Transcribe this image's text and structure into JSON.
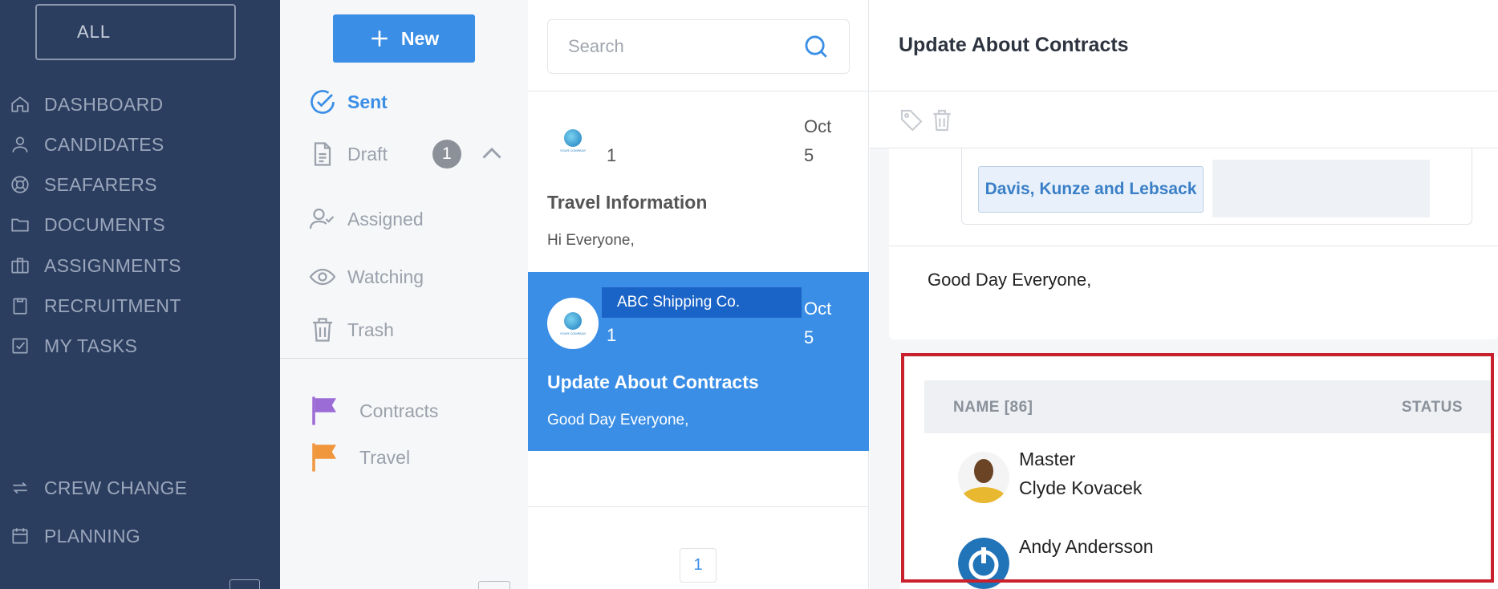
{
  "nav": {
    "filter_label": "ALL",
    "items": [
      {
        "label": "DASHBOARD",
        "icon": "home-icon"
      },
      {
        "label": "CANDIDATES",
        "icon": "user-icon"
      },
      {
        "label": "SEAFARERS",
        "icon": "lifebuoy-icon"
      },
      {
        "label": "DOCUMENTS",
        "icon": "folder-icon"
      },
      {
        "label": "ASSIGNMENTS",
        "icon": "briefcase-icon"
      },
      {
        "label": "RECRUITMENT",
        "icon": "clipboard-icon"
      },
      {
        "label": "MY TASKS",
        "icon": "checkbox-icon"
      },
      {
        "label": "CREW CHANGE",
        "icon": "swap-icon"
      },
      {
        "label": "PLANNING",
        "icon": "calendar-icon"
      }
    ]
  },
  "folders": {
    "new_label": "New",
    "sent": "Sent",
    "draft": "Draft",
    "draft_count": "1",
    "assigned": "Assigned",
    "watching": "Watching",
    "trash": "Trash",
    "labels": [
      {
        "name": "Contracts",
        "color": "#9b6bd6"
      },
      {
        "name": "Travel",
        "color": "#f0963c"
      }
    ]
  },
  "list": {
    "search_placeholder": "Search",
    "logo_text": "YOUR COMPANY",
    "messages": [
      {
        "count": "1",
        "date_month": "Oct",
        "date_day": "5",
        "title": "Travel Information",
        "preview": "Hi Everyone,",
        "selected": false
      },
      {
        "sender": "ABC Shipping Co.",
        "count": "1",
        "date_month": "Oct",
        "date_day": "5",
        "title": "Update About Contracts",
        "preview": "Good Day Everyone,",
        "selected": true
      }
    ],
    "page": "1"
  },
  "detail": {
    "title": "Update About Contracts",
    "company": "Davis, Kunze and Lebsack",
    "body": "Good Day Everyone,",
    "recipients": {
      "name_header": "NAME [86]",
      "status_header": "STATUS",
      "people": [
        {
          "role": "Master",
          "name": "Clyde Kovacek"
        },
        {
          "role": "",
          "name": "Andy Andersson"
        }
      ]
    }
  },
  "colors": {
    "nav_bg": "#2c3e5f",
    "accent": "#3a8ee6",
    "selected_sender_bg": "#1b64c7",
    "highlight_border": "#c8202c"
  }
}
